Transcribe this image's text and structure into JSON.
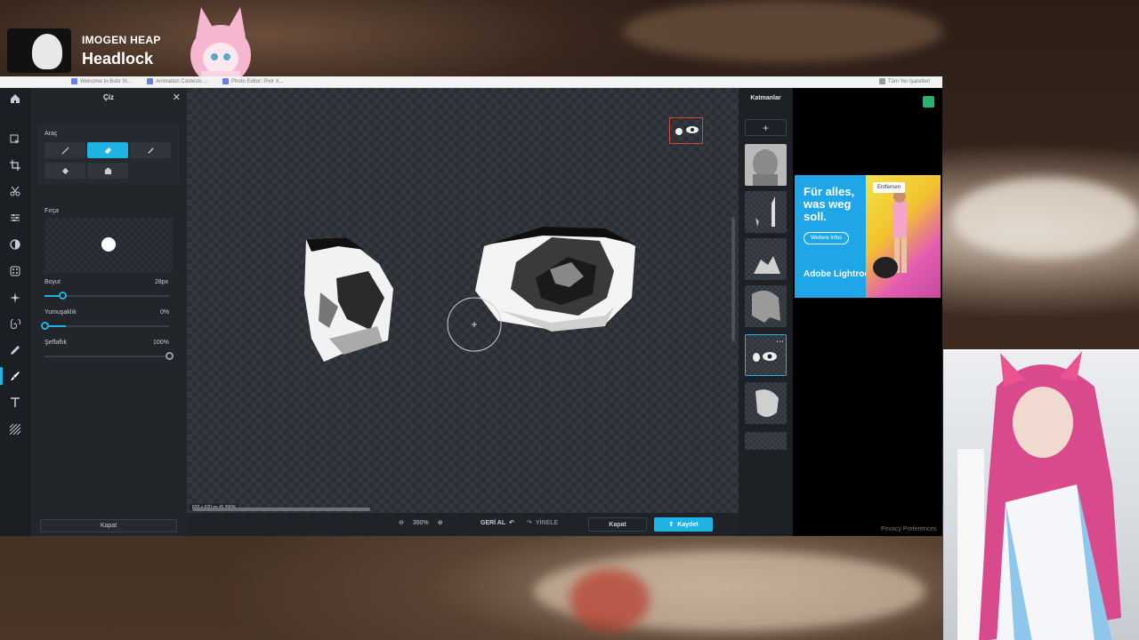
{
  "stream_overlay": {
    "artist": "IMOGEN HEAP",
    "song": "Headlock"
  },
  "browser": {
    "bookmarks": [
      "Welcome to Bsbr St...",
      "Animation Contests ...",
      "Photo Editor: Pixlr X..."
    ],
    "all_bookmarks": "Tüm Yer İşaretleri"
  },
  "editor": {
    "tools": [
      "home-icon",
      "select-icon",
      "crop-icon",
      "cutout-icon",
      "adjust-icon",
      "filter-icon",
      "effects-icon",
      "retouch-icon",
      "liquify-icon",
      "draw-icon",
      "brush-icon",
      "text-icon",
      "pattern-icon"
    ],
    "active_tool": "draw-icon",
    "panel": {
      "title": "Çiz",
      "tool_section_label": "Araç",
      "brush_section_label": "Fırça",
      "size_label": "Boyut",
      "size_value": "28px",
      "size_level": 0.14,
      "softness_label": "Yumuşaklık",
      "softness_value": "0%",
      "softness_level": 0.0,
      "opacity_label": "Şeffaflık",
      "opacity_value": "100%",
      "opacity_level": 1.0,
      "close_label": "Kapat"
    },
    "canvas": {
      "dimensions_label": "620 x 620 px @ 390%"
    },
    "bottombar": {
      "zoom": "390%",
      "undo": "GERİ AL",
      "redo": "YİNELE",
      "close": "Kapat",
      "save": "Kaydet"
    },
    "layers": {
      "title": "Katmanlar",
      "count": 7,
      "active_index": 4
    },
    "colors": {
      "accent": "#1fb2e2",
      "panel": "#22262b",
      "canvas": "#2b2f34"
    }
  },
  "ad": {
    "headline": "Für alles, was weg soll.",
    "cta": "Weitere Infos",
    "brand": "Adobe Lightroom",
    "remove": "Entfernen"
  },
  "privacy": "Privacy Preferences"
}
